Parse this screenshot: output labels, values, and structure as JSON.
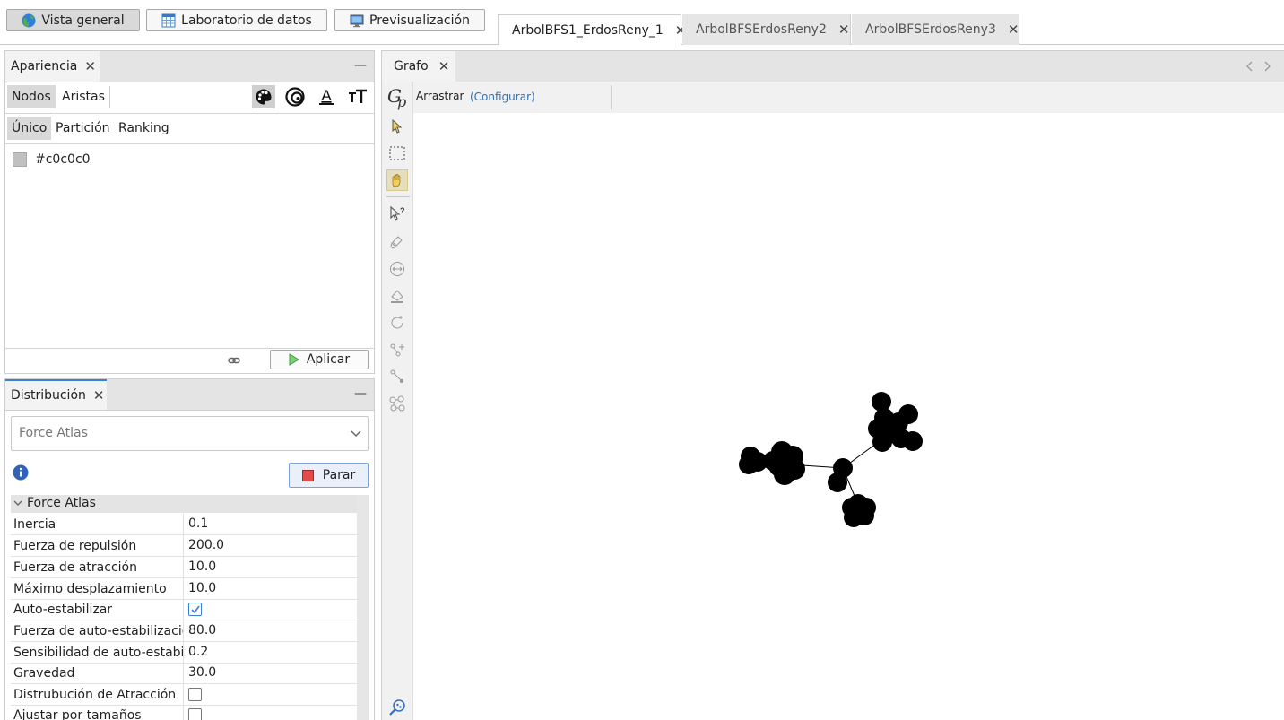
{
  "topbar": {
    "buttons": [
      {
        "label": "Vista general",
        "icon": "globe-icon"
      },
      {
        "label": "Laboratorio de datos",
        "icon": "table-icon"
      },
      {
        "label": "Previsualización",
        "icon": "monitor-icon"
      }
    ],
    "tabs": [
      {
        "label": "ArbolBFS1_ErdosReny_1",
        "active": true
      },
      {
        "label": "ArbolBFSErdosReny2",
        "active": false
      },
      {
        "label": "ArbolBFSErdosReny3",
        "active": false
      }
    ]
  },
  "appearance": {
    "title": "Apariencia",
    "element_tabs": [
      "Nodos",
      "Aristas"
    ],
    "mode_tabs": [
      "Único",
      "Partición",
      "Ranking"
    ],
    "color_value": "#c0c0c0",
    "apply_label": "Aplicar"
  },
  "layout": {
    "title": "Distribución",
    "algorithm": "Force Atlas",
    "stop_label": "Parar",
    "section": "Force Atlas",
    "props": [
      {
        "key": "Inercia",
        "value": "0.1"
      },
      {
        "key": "Fuerza de repulsión",
        "value": "200.0"
      },
      {
        "key": "Fuerza de atracción",
        "value": "10.0"
      },
      {
        "key": "Máximo desplazamiento",
        "value": "10.0"
      },
      {
        "key": "Auto-estabilizar",
        "checked": true
      },
      {
        "key": "Fuerza de auto-estabilización",
        "value": "80.0"
      },
      {
        "key": "Sensibilidad de auto-estabilización",
        "value": "0.2"
      },
      {
        "key": "Gravedad",
        "value": "30.0"
      },
      {
        "key": "Distrubución de Atracción",
        "checked": false
      },
      {
        "key": "Ajustar por tamaños",
        "checked": false
      }
    ]
  },
  "graph": {
    "title": "Grafo",
    "tool_label": "Arrastrar",
    "config_label": "(Configurar)"
  },
  "colors": {
    "accent": "#3d7fd6",
    "link": "#2a6fbb",
    "node": "#000000"
  }
}
